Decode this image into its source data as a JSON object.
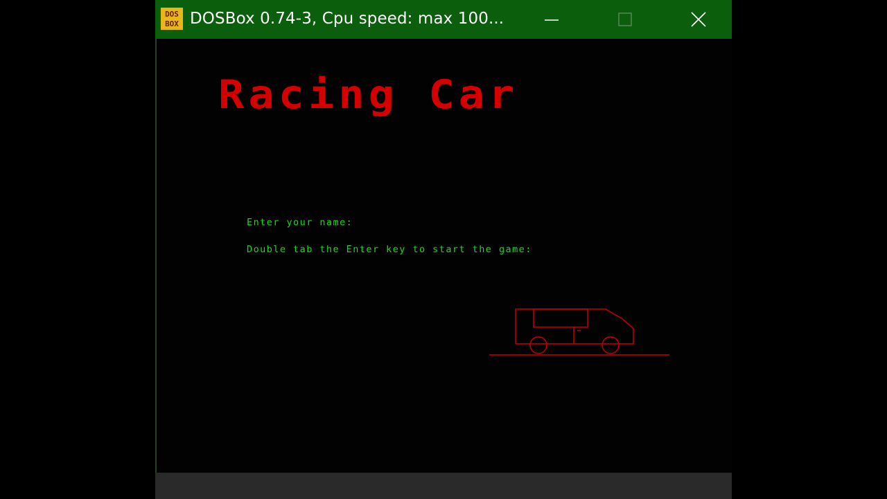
{
  "window": {
    "title": "DOSBox 0.74-3, Cpu speed: max 100...",
    "icon": "dosbox-icon",
    "icon_text_top": "DOS",
    "icon_text_bottom": "BOX",
    "titlebar_color": "#0b5e0b",
    "controls": {
      "minimize": "minimize-icon",
      "maximize": "maximize-icon",
      "close": "close-icon"
    }
  },
  "game": {
    "title": "Racing Car",
    "title_color": "#d40000",
    "prompt_name": "Enter your name:",
    "prompt_start": "Double tab the Enter key to start the game:",
    "prompt_color": "#1ed71e",
    "car_icon": "car-outline-icon"
  }
}
